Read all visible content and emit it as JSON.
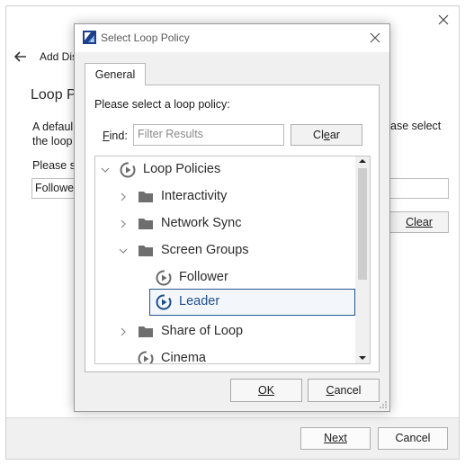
{
  "wizard": {
    "title": "Add Dis",
    "heading": "Loop Po",
    "desc_line1": "A defaul",
    "desc_line2": "the loop",
    "desc_right": "ase select",
    "please_label": "Please s",
    "policy_value": "Followe",
    "clear_label": "Clear",
    "next_label": "Next",
    "cancel_label": "Cancel"
  },
  "dialog": {
    "title": "Select Loop Policy",
    "tab_general": "General",
    "prompt": "Please select a loop policy:",
    "find_label": "Find:",
    "find_placeholder": "Filter Results",
    "clear_label": "Clear",
    "ok_label": "OK",
    "cancel_label": "Cancel",
    "tree": [
      {
        "label": "Loop Policies",
        "icon": "loop-policy-icon",
        "expanded": true
      },
      {
        "label": "Interactivity",
        "icon": "folder-icon",
        "expanded": false
      },
      {
        "label": "Network Sync",
        "icon": "folder-icon",
        "expanded": false
      },
      {
        "label": "Screen Groups",
        "icon": "folder-icon",
        "expanded": true
      },
      {
        "label": "Follower",
        "icon": "loop-policy-icon"
      },
      {
        "label": "Leader",
        "icon": "loop-policy-icon",
        "selected": true
      },
      {
        "label": "Share of Loop",
        "icon": "folder-icon",
        "expanded": false
      },
      {
        "label": "Cinema",
        "icon": "loop-policy-icon"
      }
    ]
  },
  "colors": {
    "accent": "#1f4e8c",
    "selection_border": "#26558e",
    "dialog_bg": "#f0f0f0"
  }
}
